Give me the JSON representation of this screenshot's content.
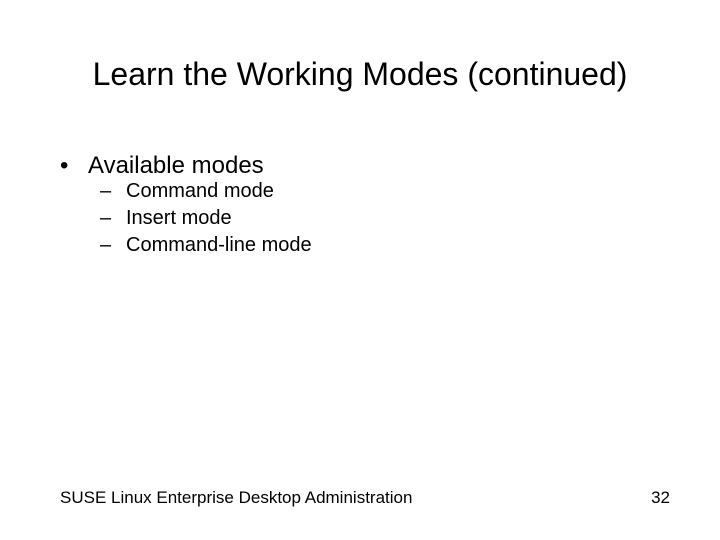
{
  "title": "Learn the Working Modes (continued)",
  "bullet_char": "•",
  "dash_char": "–",
  "lvl1_label": "Available modes",
  "modes": {
    "0": "Command mode",
    "1": "Insert mode",
    "2": "Command-line mode"
  },
  "footer_text": "SUSE Linux Enterprise Desktop Administration",
  "page_number": "32"
}
